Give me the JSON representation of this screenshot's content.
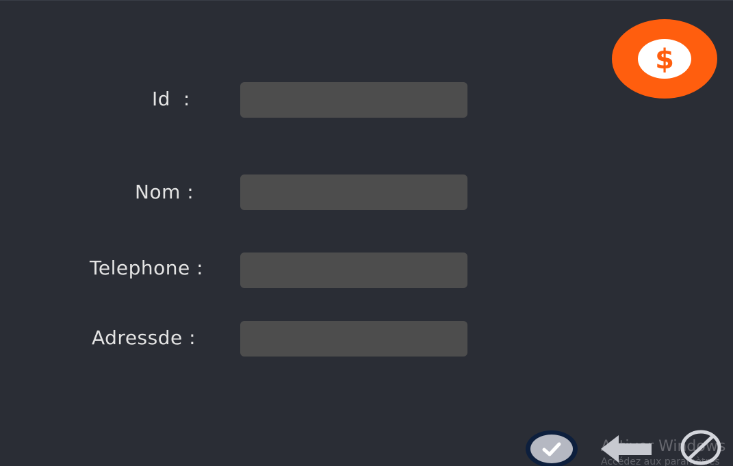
{
  "form": {
    "id_label": "Id  :",
    "id_value": "",
    "nom_label": "Nom :",
    "nom_value": "",
    "telephone_label": "Telephone :",
    "telephone_value": "",
    "adresse_label": "Adressde :",
    "adresse_value": ""
  },
  "icons": {
    "money": "dollar-icon",
    "confirm": "checkmark-icon",
    "back": "arrow-left-icon",
    "cancel": "cancel-icon"
  },
  "colors": {
    "background": "#2a2d35",
    "input_background": "#4d4d4d",
    "accent": "#ff5e0e",
    "confirm_ring": "#0d1f3d"
  },
  "watermark": {
    "title": "Activer Windows",
    "subtitle": "Accédez aux paramètres"
  }
}
